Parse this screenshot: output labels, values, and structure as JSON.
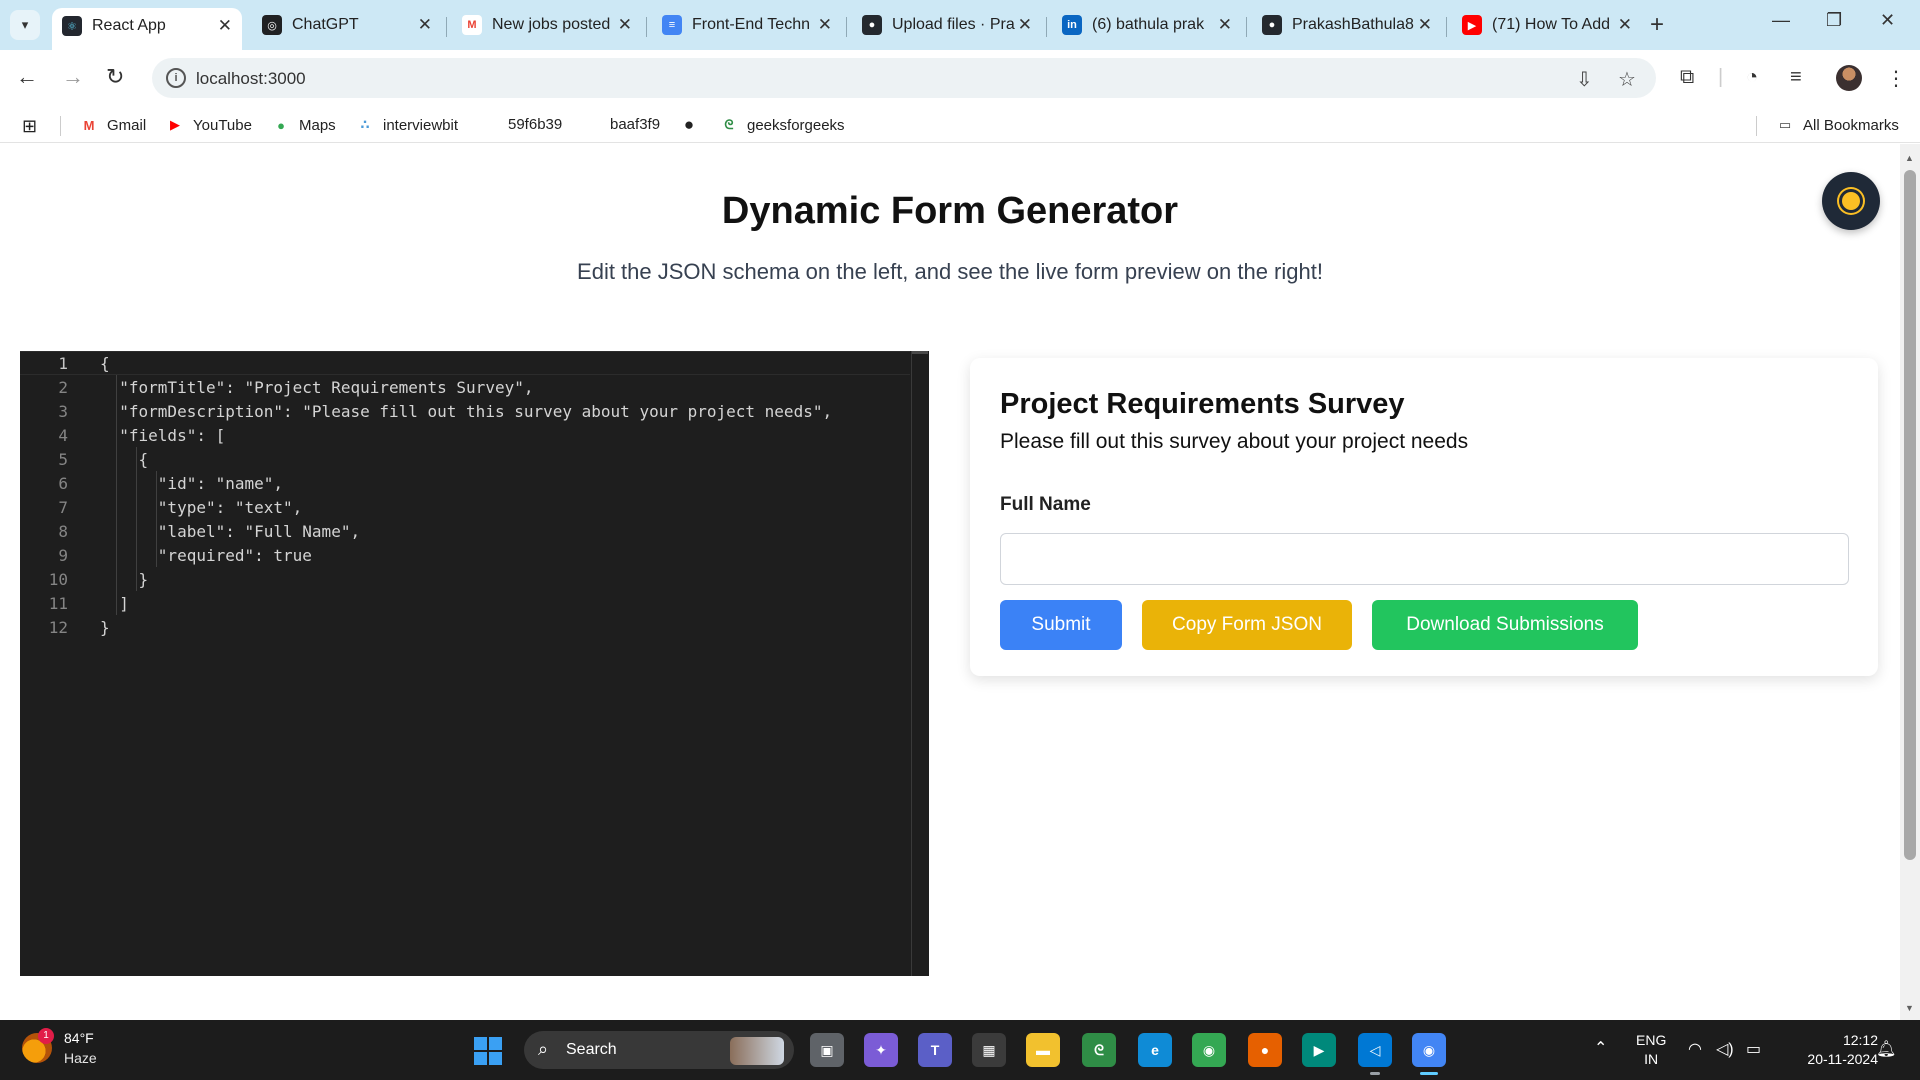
{
  "browser": {
    "tabs": [
      {
        "title": "React App",
        "favicon_color": "#23272f",
        "favicon_glyph": "⚛",
        "active": true
      },
      {
        "title": "ChatGPT",
        "favicon_color": "#202123",
        "favicon_glyph": "◎",
        "active": false
      },
      {
        "title": "New jobs posted",
        "favicon_color": "#ea4335",
        "favicon_glyph": "M",
        "active": false
      },
      {
        "title": "Front-End Techn",
        "favicon_color": "#4285f4",
        "favicon_glyph": "≡",
        "active": false
      },
      {
        "title": "Upload files · Pra",
        "favicon_color": "#24292f",
        "favicon_glyph": "●",
        "active": false
      },
      {
        "title": "(6) bathula prak",
        "favicon_color": "#0a66c2",
        "favicon_glyph": "in",
        "active": false
      },
      {
        "title": "PrakashBathula8",
        "favicon_color": "#24292f",
        "favicon_glyph": "●",
        "active": false
      },
      {
        "title": "(71) How To Add",
        "favicon_color": "#ff0000",
        "favicon_glyph": "▶",
        "active": false
      }
    ],
    "url": "localhost:3000",
    "bookmarks": [
      {
        "label": "Gmail",
        "icon": "gmail-icon",
        "glyph": "M",
        "color": "#ea4335"
      },
      {
        "label": "YouTube",
        "icon": "youtube-icon",
        "glyph": "▶",
        "color": "#ff0000"
      },
      {
        "label": "Maps",
        "icon": "maps-icon",
        "glyph": "●",
        "color": "#34a853"
      },
      {
        "label": "interviewbit",
        "icon": "interviewbit-icon",
        "glyph": "∴",
        "color": "#4b9ad8"
      },
      {
        "label": "59f6b39",
        "icon": "",
        "glyph": "",
        "color": ""
      },
      {
        "label": "baaf3f9",
        "icon": "",
        "glyph": "",
        "color": ""
      },
      {
        "label": "",
        "icon": "globe-icon",
        "glyph": "●",
        "color": "#222222"
      },
      {
        "label": "geeksforgeeks",
        "icon": "geeksforgeeks-icon",
        "glyph": "ᘓ",
        "color": "#2f8d46"
      }
    ],
    "all_bookmarks_label": "All Bookmarks"
  },
  "page": {
    "title": "Dynamic Form Generator",
    "subtitle": "Edit the JSON schema on the left, and see the live form preview on the right!",
    "editor": {
      "current_line": 1,
      "lines": [
        {
          "no": "1",
          "text": "{"
        },
        {
          "no": "2",
          "text": "  \"formTitle\": \"Project Requirements Survey\","
        },
        {
          "no": "3",
          "text": "  \"formDescription\": \"Please fill out this survey about your project needs\","
        },
        {
          "no": "4",
          "text": "  \"fields\": ["
        },
        {
          "no": "5",
          "text": "    {"
        },
        {
          "no": "6",
          "text": "      \"id\": \"name\","
        },
        {
          "no": "7",
          "text": "      \"type\": \"text\","
        },
        {
          "no": "8",
          "text": "      \"label\": \"Full Name\","
        },
        {
          "no": "9",
          "text": "      \"required\": true"
        },
        {
          "no": "10",
          "text": "    }"
        },
        {
          "no": "11",
          "text": "  ]"
        },
        {
          "no": "12",
          "text": "}"
        }
      ]
    },
    "form": {
      "title": "Project Requirements Survey",
      "description": "Please fill out this survey about your project needs",
      "field_label": "Full Name",
      "field_value": "",
      "submit_label": "Submit",
      "copy_label": "Copy Form JSON",
      "download_label": "Download Submissions"
    }
  },
  "taskbar": {
    "weather_temp": "84°F",
    "weather_condition": "Haze",
    "weather_badge": "1",
    "search_label": "Search",
    "lang_line1": "ENG",
    "lang_line2": "IN",
    "time": "12:12",
    "date": "20-11-2024",
    "apps": [
      {
        "name": "task-view",
        "color": "#5f6368",
        "glyph": "▣"
      },
      {
        "name": "copilot",
        "color": "#7b5cd6",
        "glyph": "✦"
      },
      {
        "name": "teams",
        "color": "#5b5fc7",
        "glyph": "T"
      },
      {
        "name": "microsoft-store",
        "color": "#3b3b3b",
        "glyph": "▦"
      },
      {
        "name": "file-explorer",
        "color": "#f2c12e",
        "glyph": "▬"
      },
      {
        "name": "geeksforgeeks",
        "color": "#2f8d46",
        "glyph": "ᘓ"
      },
      {
        "name": "edge",
        "color": "#0f8bd6",
        "glyph": "e"
      },
      {
        "name": "chrome",
        "color": "#34a853",
        "glyph": "◉"
      },
      {
        "name": "firefox",
        "color": "#e66000",
        "glyph": "●"
      },
      {
        "name": "meet",
        "color": "#00897b",
        "glyph": "▶"
      },
      {
        "name": "vscode",
        "color": "#0078d4",
        "glyph": "◁"
      },
      {
        "name": "chrome-profile",
        "color": "#4285f4",
        "glyph": "◉"
      }
    ]
  }
}
